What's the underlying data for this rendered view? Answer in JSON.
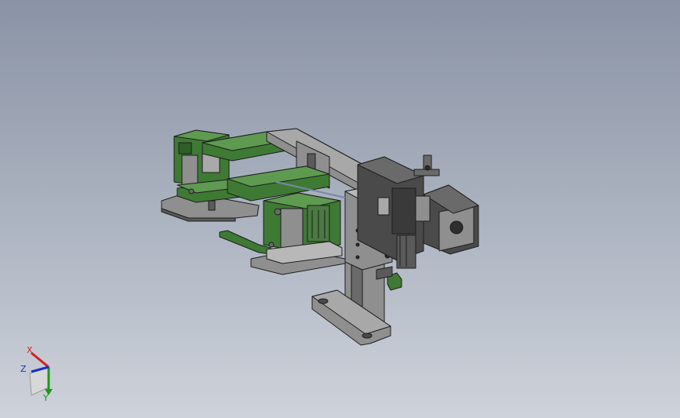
{
  "viewport": {
    "background_top": "#8a93a5",
    "background_bottom": "#ced2da"
  },
  "model": {
    "part_colors": {
      "frame_gray": "#8f8f8f",
      "dark_gray": "#4a4a4a",
      "green": "#3e7a34",
      "light_gray": "#b8b8b8",
      "edge": "#1e1e1e"
    }
  },
  "triad": {
    "x_label": "X",
    "y_label": "Y",
    "z_label": "Z",
    "x_color": "#d21f1f",
    "y_color": "#1a9a1a",
    "z_color": "#1c2ec8"
  }
}
